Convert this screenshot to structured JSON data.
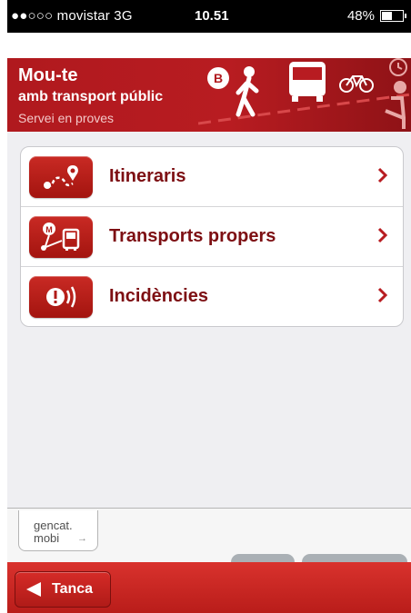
{
  "status_bar": {
    "carrier": "●●○○○ movistar  3G",
    "time": "10.51",
    "battery": "48%",
    "battery_level": 0.48
  },
  "banner": {
    "title": "Mou-te",
    "subtitle": "amb transport públic",
    "note": "Servei en proves",
    "colors": {
      "brand": "#b0191e",
      "label": "#7d0f13"
    }
  },
  "menu": {
    "items": [
      {
        "label": "Itineraris",
        "icon": "route-icon"
      },
      {
        "label": "Transports propers",
        "icon": "nearby-transport-icon"
      },
      {
        "label": "Incidències",
        "icon": "alert-icon"
      }
    ]
  },
  "footer": {
    "logo_line1": "gencat.",
    "logo_line2": "mobi",
    "logo_arrow": "→"
  },
  "toolbar": {
    "close_label": "Tanca"
  }
}
